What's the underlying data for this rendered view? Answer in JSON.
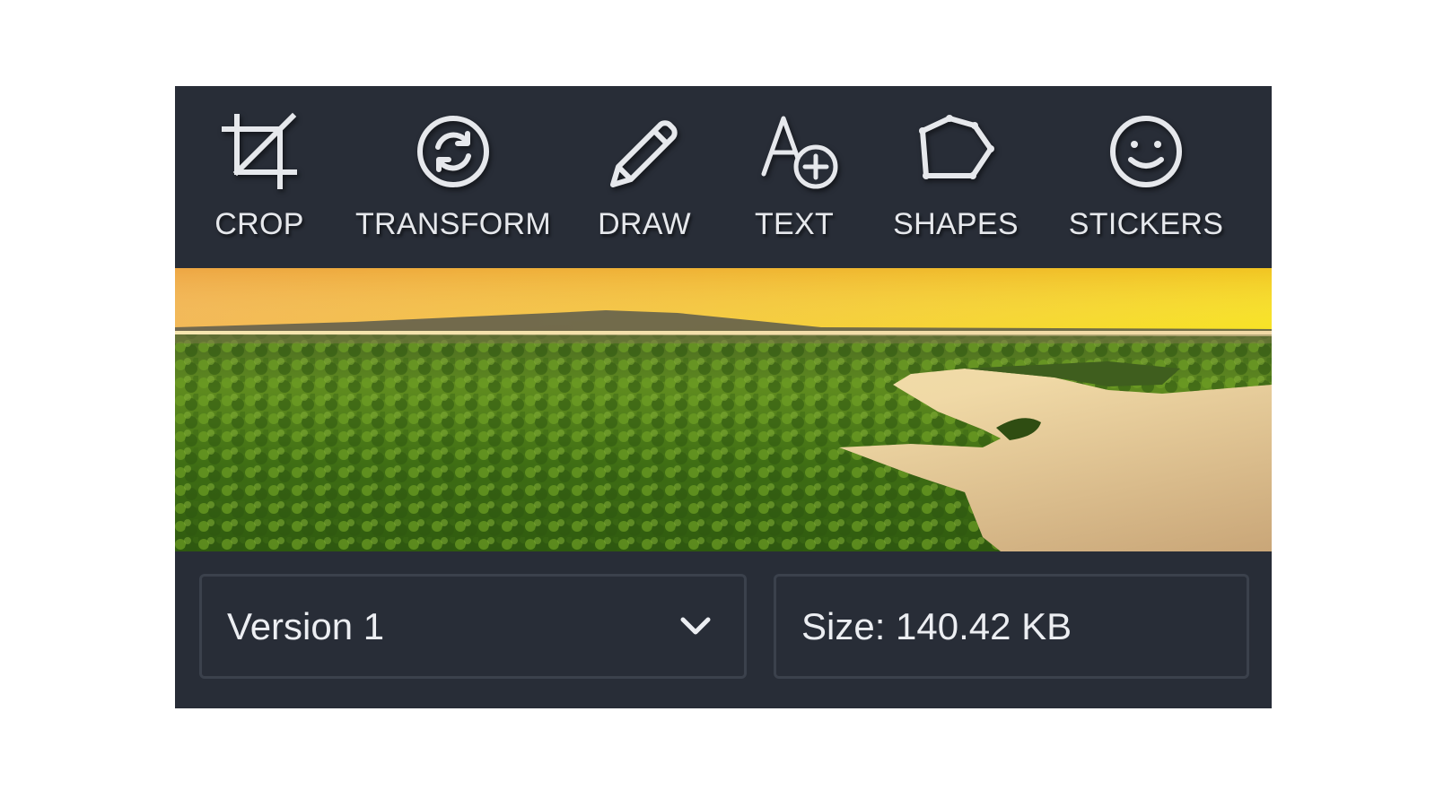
{
  "toolbar": {
    "tools": [
      {
        "id": "crop",
        "label": "CROP",
        "icon": "crop-icon"
      },
      {
        "id": "transform",
        "label": "TRANSFORM",
        "icon": "rotate-icon"
      },
      {
        "id": "draw",
        "label": "DRAW",
        "icon": "pencil-icon"
      },
      {
        "id": "text",
        "label": "TEXT",
        "icon": "text-add-icon"
      },
      {
        "id": "shapes",
        "label": "SHAPES",
        "icon": "polygon-icon"
      },
      {
        "id": "stickers",
        "label": "STICKERS",
        "icon": "smiley-icon"
      }
    ]
  },
  "image": {
    "subject": "aerial-forest-lake-sunset"
  },
  "footer": {
    "version_select": {
      "selected": "Version 1"
    },
    "size_label": "Size: 140.42 KB"
  },
  "colors": {
    "panel": "#282d37",
    "field_border": "#3b414c",
    "text": "#e6e8ec",
    "icon_stroke": "#e6e8ec"
  }
}
